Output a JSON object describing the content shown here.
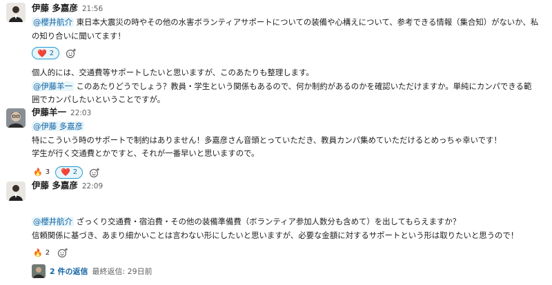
{
  "messages": [
    {
      "author": "伊藤 多嘉彦",
      "time": "21:56",
      "line1_mention": "@櫻井航介",
      "line1_text": " 東日本大震災の時やその他の水害ボランティアサポートについての装備や心構えについて、参考できる情報（集合知）がないか、私",
      "line2": "の知り合いに聞いてます！",
      "reactions": [
        {
          "emoji": "heart",
          "glyph": "❤️",
          "count": "2",
          "active": true
        }
      ],
      "cont1": "個人的には、交通費等サポートしたいと思いますが、このあたりも整理します。",
      "cont2_mention": "@伊藤羊一",
      "cont2_text": " このあたりどうでしょう？教員・学生という関係もあるので、何か制約があるのかを確認いただけますか。単純にカンパできる範",
      "cont3": "囲でカンパしたいということですが。"
    },
    {
      "author": "伊藤羊一",
      "time": "22:03",
      "mention": "@伊藤 多嘉彦",
      "line1": "特にこういう時のサポートで制約はありません！多嘉彦さん音頭とっていただき、教員カンパ集めていただけるとめっちゃ幸いです！",
      "line2": "学生が行く交通費とかですと、それが一番早いと思いますので。",
      "reactions": [
        {
          "emoji": "fire",
          "glyph": "🔥",
          "count": "3",
          "active": false
        },
        {
          "emoji": "heart",
          "glyph": "❤️",
          "count": "2",
          "active": true
        }
      ]
    },
    {
      "author": "伊藤 多嘉彦",
      "time": "22:09",
      "line1_mention": "@櫻井航介",
      "line1_text": " ざっくり交通費・宿泊費・その他の装備準備費（ボランティア参加人数分も含めて）を出してもらえますか？",
      "line2": "信頼関係に基づき、あまり細かいことは言わない形にしたいと思いますが、必要な金額に対するサポートという形は取りたいと思うので！",
      "reactions": [
        {
          "emoji": "fire",
          "glyph": "🔥",
          "count": "2",
          "active": false
        }
      ],
      "thread": {
        "replies": "2 件の返信",
        "last_reply": "最終返信: 29日前"
      }
    }
  ],
  "colors": {
    "mention_bg": "#e8f5fa",
    "mention_text": "#1264a3",
    "active_border": "#1d9bd1"
  }
}
